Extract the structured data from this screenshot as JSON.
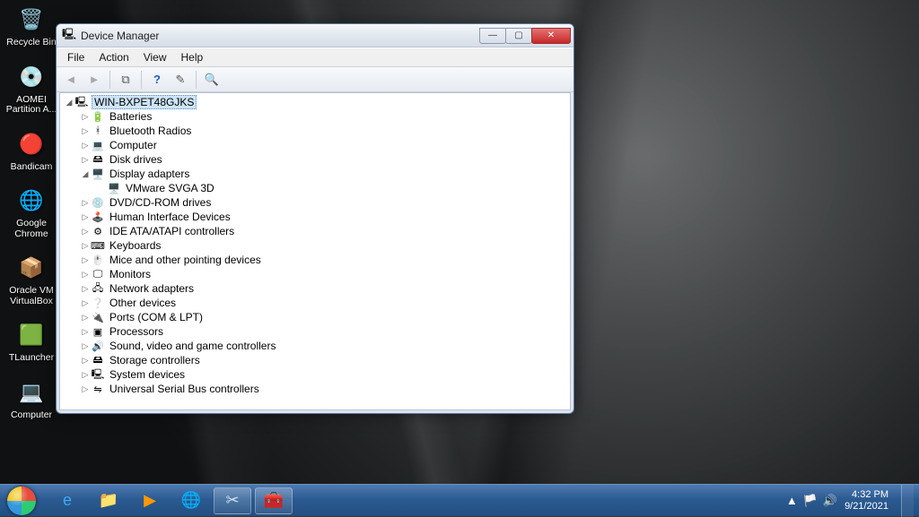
{
  "desktop": {
    "icons": [
      {
        "name": "recycle-bin",
        "label": "Recycle Bin",
        "glyph": "🗑️"
      },
      {
        "name": "aomei-partition",
        "label": "AOMEI Partition A...",
        "glyph": "💿"
      },
      {
        "name": "bandicam",
        "label": "Bandicam",
        "glyph": "🔴"
      },
      {
        "name": "google-chrome",
        "label": "Google Chrome",
        "glyph": "🌐"
      },
      {
        "name": "oracle-virtualbox",
        "label": "Oracle VM VirtualBox",
        "glyph": "📦"
      },
      {
        "name": "tlauncher",
        "label": "TLauncher",
        "glyph": "🟩"
      },
      {
        "name": "computer",
        "label": "Computer",
        "glyph": "💻"
      }
    ]
  },
  "window": {
    "title": "Device Manager",
    "menus": [
      "File",
      "Action",
      "View",
      "Help"
    ],
    "toolbar": {
      "back": "◄",
      "forward": "►",
      "up": "⧉",
      "help": "?",
      "props": "✎",
      "scan": "🔍"
    },
    "tree": {
      "root": "WIN-BXPET48GJKS",
      "nodes": [
        {
          "label": "Batteries",
          "icon": "🔋"
        },
        {
          "label": "Bluetooth Radios",
          "icon": "ᚼ"
        },
        {
          "label": "Computer",
          "icon": "💻"
        },
        {
          "label": "Disk drives",
          "icon": "🖴"
        },
        {
          "label": "Display adapters",
          "icon": "🖥️",
          "expanded": true,
          "children": [
            {
              "label": "VMware SVGA 3D",
              "icon": "🖥️"
            }
          ]
        },
        {
          "label": "DVD/CD-ROM drives",
          "icon": "💿"
        },
        {
          "label": "Human Interface Devices",
          "icon": "🕹️"
        },
        {
          "label": "IDE ATA/ATAPI controllers",
          "icon": "⚙"
        },
        {
          "label": "Keyboards",
          "icon": "⌨"
        },
        {
          "label": "Mice and other pointing devices",
          "icon": "🖱️"
        },
        {
          "label": "Monitors",
          "icon": "🖵"
        },
        {
          "label": "Network adapters",
          "icon": "🖧"
        },
        {
          "label": "Other devices",
          "icon": "❔"
        },
        {
          "label": "Ports (COM & LPT)",
          "icon": "🔌"
        },
        {
          "label": "Processors",
          "icon": "▣"
        },
        {
          "label": "Sound, video and game controllers",
          "icon": "🔊"
        },
        {
          "label": "Storage controllers",
          "icon": "🖴"
        },
        {
          "label": "System devices",
          "icon": "🖳"
        },
        {
          "label": "Universal Serial Bus controllers",
          "icon": "⇋"
        }
      ]
    }
  },
  "taskbar": {
    "pins": [
      {
        "name": "ie",
        "glyph": "e",
        "color": "#3fa9f5"
      },
      {
        "name": "explorer",
        "glyph": "📁",
        "color": ""
      },
      {
        "name": "wmp",
        "glyph": "▶",
        "color": "#ff9800"
      },
      {
        "name": "chrome",
        "glyph": "🌐",
        "color": ""
      },
      {
        "name": "snip",
        "glyph": "✂",
        "color": "#cfe3f7",
        "active": true
      },
      {
        "name": "devmgr",
        "glyph": "🧰",
        "color": "",
        "active": true
      }
    ],
    "tray": {
      "icons": [
        "▲",
        "🏳️",
        "🔊"
      ],
      "time": "4:32 PM",
      "date": "9/21/2021"
    }
  }
}
